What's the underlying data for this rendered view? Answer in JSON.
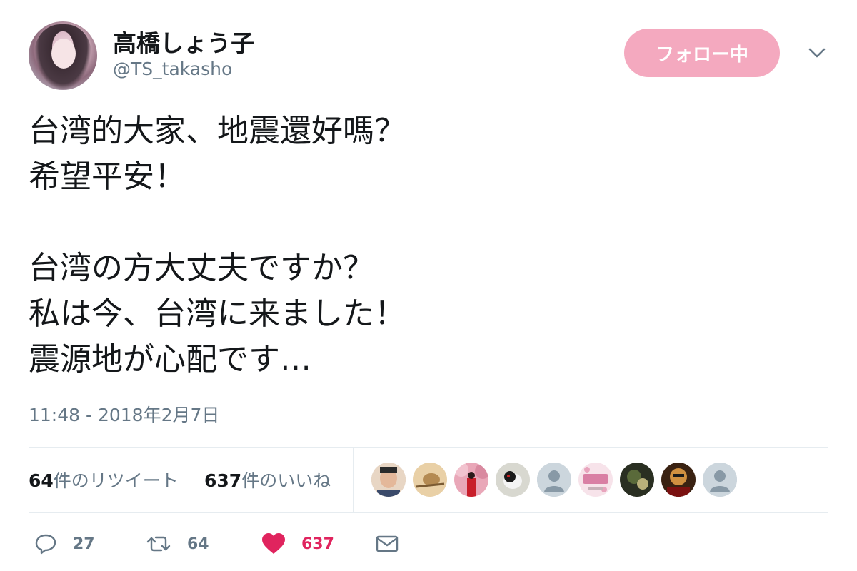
{
  "user": {
    "display_name": "高橋しょう子",
    "handle": "@TS_takasho"
  },
  "follow_button": {
    "label": "フォロー中",
    "color": "#f4a9bf"
  },
  "tweet": {
    "lines": [
      "台湾的大家、地震還好嗎？",
      "希望平安！",
      "",
      "台湾の方大丈夫ですか？",
      "私は今、台湾に来ました！",
      "震源地が心配です…"
    ],
    "timestamp": "11:48 - 2018年2月7日"
  },
  "stats": {
    "retweet_count": "64",
    "retweet_label": "件のリツイート",
    "like_count": "637",
    "like_label": "件のいいね",
    "liker_avatars": [
      "avatar-man",
      "avatar-bird",
      "avatar-red-figure",
      "avatar-bird-2",
      "avatar-default",
      "avatar-hearts",
      "avatar-dark",
      "avatar-costume",
      "avatar-default"
    ]
  },
  "actions": {
    "reply_count": "27",
    "retweet_count": "64",
    "like_count": "637",
    "icons": [
      "reply-icon",
      "retweet-icon",
      "heart-icon",
      "envelope-icon"
    ]
  },
  "colors": {
    "text": "#14171a",
    "secondary": "#657786",
    "like": "#e0245e",
    "divider": "#e6ecf0"
  }
}
